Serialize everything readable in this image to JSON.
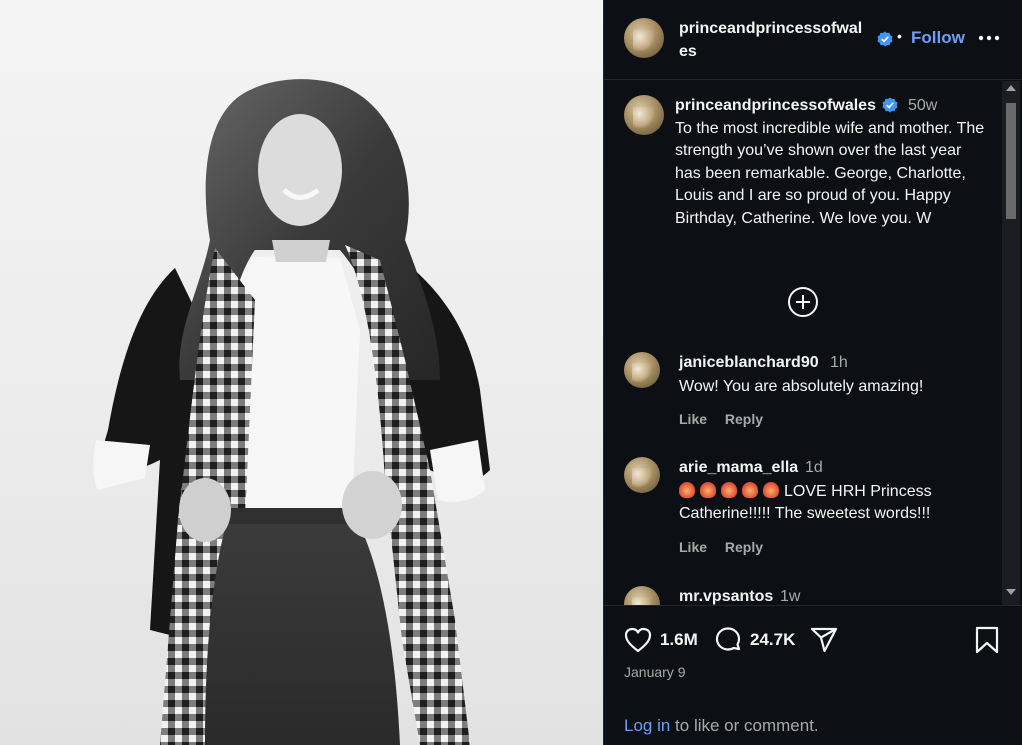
{
  "post": {
    "author": "princeandprincessofwales",
    "author_wrapped_1": "princeandprincessofwal",
    "author_wrapped_2": "es",
    "dot": "•",
    "follow_label": "Follow",
    "more_icon": "more-horizontal-icon",
    "caption_time": "50w",
    "caption": "To the most incredible wife and mother. The strength you’ve shown over the last year has been remarkable. George, Charlotte, Louis and I are so proud of you. Happy Birthday, Catherine. We love you. W",
    "more_comments_icon": "plus-circle-icon"
  },
  "comments": [
    {
      "user": "janiceblanchard90",
      "time": "1h",
      "text": "Wow! You are absolutely amazing!",
      "like": "Like",
      "reply": "Reply"
    },
    {
      "user": "arie_mama_ella",
      "time": "1d",
      "text": "LOVE HRH Princess Catherine!!!!! The sweetest words!!!",
      "emoji_count": 5,
      "like": "Like",
      "reply": "Reply"
    },
    {
      "user": "mr.vpsantos",
      "time": "1w"
    }
  ],
  "actions": {
    "likes": "1.6M",
    "comments": "24.7K",
    "date": "January 9",
    "login_link": "Log in",
    "login_rest": " to like or comment."
  },
  "colors": {
    "background": "#0c1014",
    "link": "#6c9ff6",
    "verified": "#4096f3",
    "muted": "#a8a8a8"
  }
}
